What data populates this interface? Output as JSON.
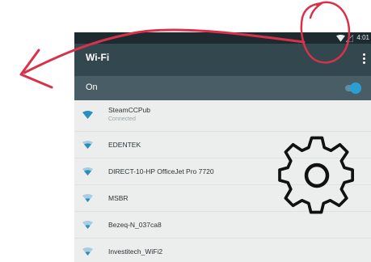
{
  "status_bar": {
    "time": "4:01"
  },
  "app_bar": {
    "title": "Wi-Fi"
  },
  "master_toggle": {
    "label": "On",
    "state": "on"
  },
  "networks": [
    {
      "name": "SteamCCPub",
      "status": "Connected"
    },
    {
      "name": "EDENTEK",
      "status": ""
    },
    {
      "name": "DIRECT-10-HP OfficeJet Pro 7720",
      "status": ""
    },
    {
      "name": "MSBR",
      "status": ""
    },
    {
      "name": "Bezeq-N_037ca8",
      "status": ""
    },
    {
      "name": "Investitech_WiFi2",
      "status": ""
    }
  ],
  "colors": {
    "accent": "#2aa0d2",
    "app_bar": "#33474f",
    "annotation": "#d8324a"
  },
  "icons": [
    "wifi-icon",
    "signal-icon",
    "more-vert-icon",
    "settings-gear-icon",
    "arrow-icon"
  ]
}
